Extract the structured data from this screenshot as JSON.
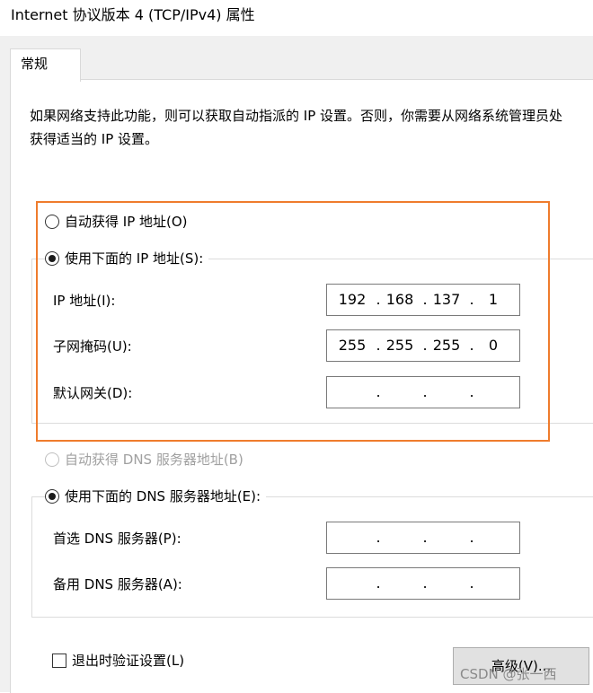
{
  "window": {
    "title": "Internet 协议版本 4 (TCP/IPv4) 属性"
  },
  "tabs": [
    {
      "label": "常规"
    }
  ],
  "description": "如果网络支持此功能，则可以获取自动指派的 IP 设置。否则，你需要从网络系统管理员处获得适当的 IP 设置。",
  "ip_settings": {
    "auto_option": {
      "label": "自动获得 IP 地址(O)",
      "selected": false
    },
    "manual_option": {
      "label": "使用下面的 IP 地址(S):",
      "selected": true
    },
    "fields": [
      {
        "label": "IP 地址(I):",
        "octets": [
          "192",
          "168",
          "137",
          "1"
        ]
      },
      {
        "label": "子网掩码(U):",
        "octets": [
          "255",
          "255",
          "255",
          "0"
        ]
      },
      {
        "label": "默认网关(D):",
        "octets": [
          "",
          "",
          "",
          ""
        ]
      }
    ]
  },
  "dns_settings": {
    "auto_option": {
      "label": "自动获得 DNS 服务器地址(B)",
      "selected": false,
      "disabled": true
    },
    "manual_option": {
      "label": "使用下面的 DNS 服务器地址(E):",
      "selected": true
    },
    "fields": [
      {
        "label": "首选 DNS 服务器(P):",
        "octets": [
          "",
          "",
          "",
          ""
        ]
      },
      {
        "label": "备用 DNS 服务器(A):",
        "octets": [
          "",
          "",
          "",
          ""
        ]
      }
    ]
  },
  "validate_on_exit": {
    "label": "退出时验证设置(L)",
    "checked": false
  },
  "advanced_button": {
    "label": "高级(V)..."
  },
  "watermark": "CSDN @张一西",
  "colors": {
    "highlight": "#ef7c2d",
    "panel": "#ffffff",
    "chrome": "#f0f0f0"
  }
}
